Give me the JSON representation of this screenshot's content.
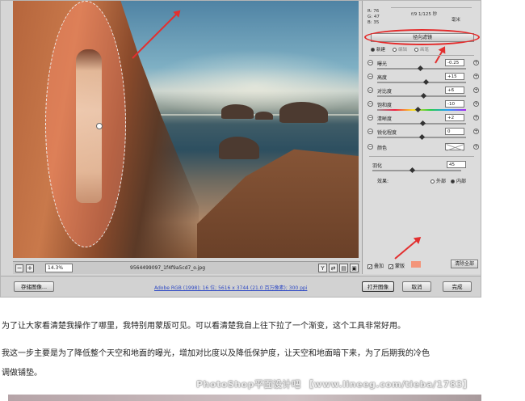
{
  "readout": {
    "r": "R:  76",
    "g": "G:  47",
    "b": "B:  35"
  },
  "exif": {
    "aperture_shutter": "f/9   1/125 秒",
    "extra": "毫米"
  },
  "panel": {
    "tool_title": "径向滤镜",
    "modes": [
      "新建",
      "编辑",
      "画笔"
    ],
    "sliders": [
      {
        "label": "曝光",
        "value": "-0.25",
        "thumb": 0.49
      },
      {
        "label": "高度",
        "value": "+15",
        "thumb": 0.55
      },
      {
        "label": "对比度",
        "value": "+6",
        "thumb": 0.52
      },
      {
        "label": "饱和度",
        "value": "-10",
        "thumb": 0.46
      },
      {
        "label": "清晰度",
        "value": "+2",
        "thumb": 0.51
      },
      {
        "label": "锐化程度",
        "value": "0",
        "thumb": 0.5
      }
    ],
    "color_label": "颜色",
    "feather": {
      "label": "羽化",
      "value": "45",
      "thumb": 0.45
    },
    "effect": {
      "label": "效果:",
      "outside": "外部",
      "inside": "内部",
      "selected": "内部"
    },
    "overlay_label": "叠加",
    "mask_label": "蒙版",
    "mask_color": "#f3957a",
    "clear_all": "清除全部"
  },
  "status": {
    "zoom": "14.3%",
    "filename": "9564499097_1f4f9a5cd7_o.jpg",
    "info_icon": "!"
  },
  "bottom": {
    "save_image": "存储图像...",
    "workflow_link": "Adobe RGB (1998); 16 位; 5616 x 3744 (21.0 百万像素); 300 ppi",
    "open_image": "打开图像",
    "cancel": "取消",
    "done": "完成"
  },
  "article": {
    "para1": "为了让大家看清楚我操作了哪里，我特别用蒙版可见。可以看清楚我自上往下拉了一个渐变，这个工具非常好用。",
    "para2_line1": "我这一步主要是为了降低整个天空和地面的曝光，增加对比度以及降低保护度，让天空和地面暗下来，为了后期我的冷色",
    "para2_line2": "调做铺垫。",
    "watermark": "PhotoShop平面设计吧 【www.lineeg.com/tieba/1783】"
  }
}
